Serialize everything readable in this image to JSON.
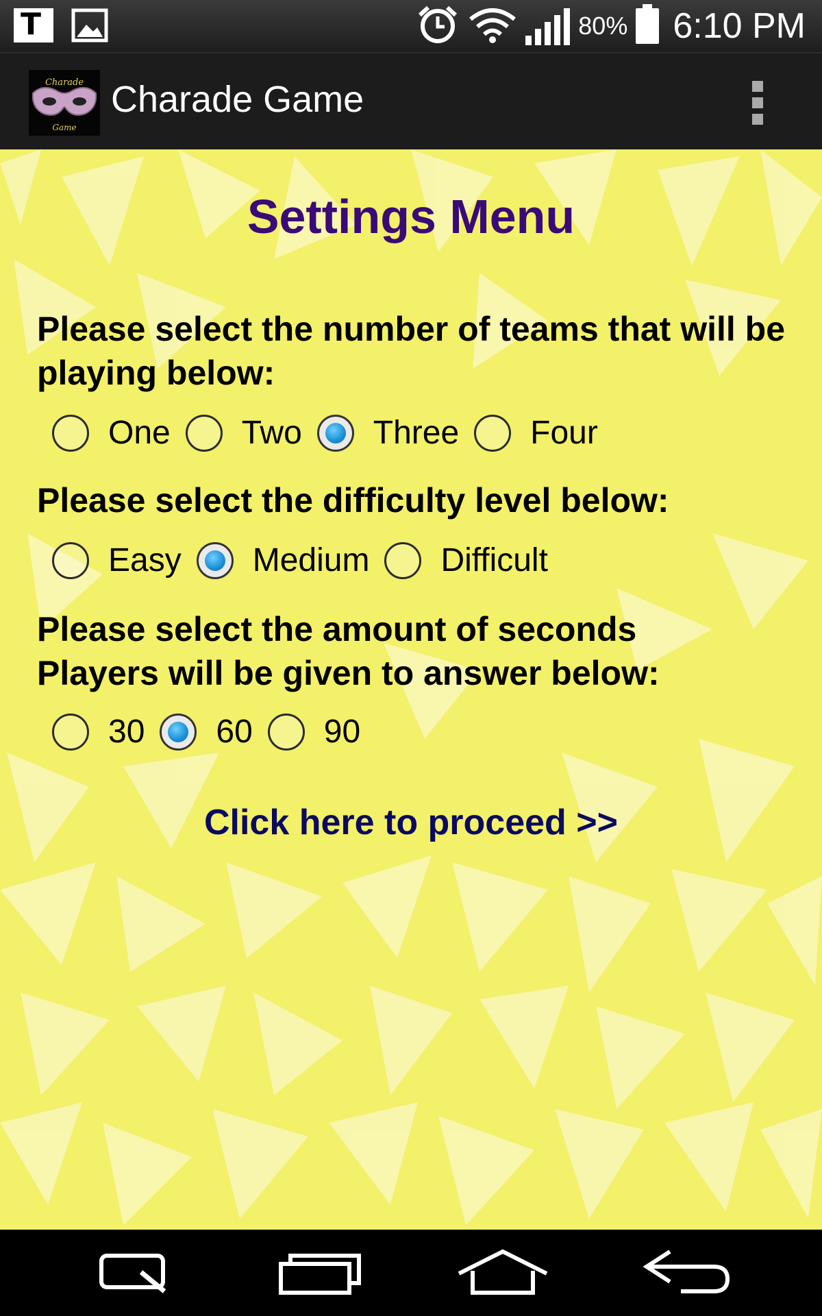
{
  "status_bar": {
    "left_icons": [
      "t-notification-icon",
      "image-notification-icon"
    ],
    "right_icons": [
      "alarm-icon",
      "wifi-icon",
      "signal-icon",
      "battery-icon"
    ],
    "battery_percent": "80%",
    "time": "6:10 PM"
  },
  "action_bar": {
    "title": "Charade Game",
    "icon": "charade-game-mask-logo",
    "logo_text_top": "Charade",
    "logo_text_bottom": "Game",
    "overflow_icon": "overflow-menu-icon"
  },
  "settings": {
    "heading": "Settings Menu",
    "teams": {
      "question": "Please select the number of teams that will be playing below:",
      "options": [
        "One",
        "Two",
        "Three",
        "Four"
      ],
      "selected": "Three"
    },
    "difficulty": {
      "question": "Please select the difficulty level below:",
      "options": [
        "Easy",
        "Medium",
        "Difficult"
      ],
      "selected": "Medium"
    },
    "seconds": {
      "question": "Please select the amount of seconds Players will be given to answer below:",
      "options": [
        "30",
        "60",
        "90"
      ],
      "selected": "60"
    },
    "proceed_label": "Click here to proceed >>"
  },
  "colors": {
    "background": "#f3f06a",
    "heading": "#3a0a78",
    "proceed": "#0a0a60",
    "radio_checked": "#1a8fd6"
  },
  "nav_bar": {
    "buttons": [
      "quick-memo-icon",
      "recent-apps-icon",
      "home-icon",
      "back-icon"
    ]
  }
}
